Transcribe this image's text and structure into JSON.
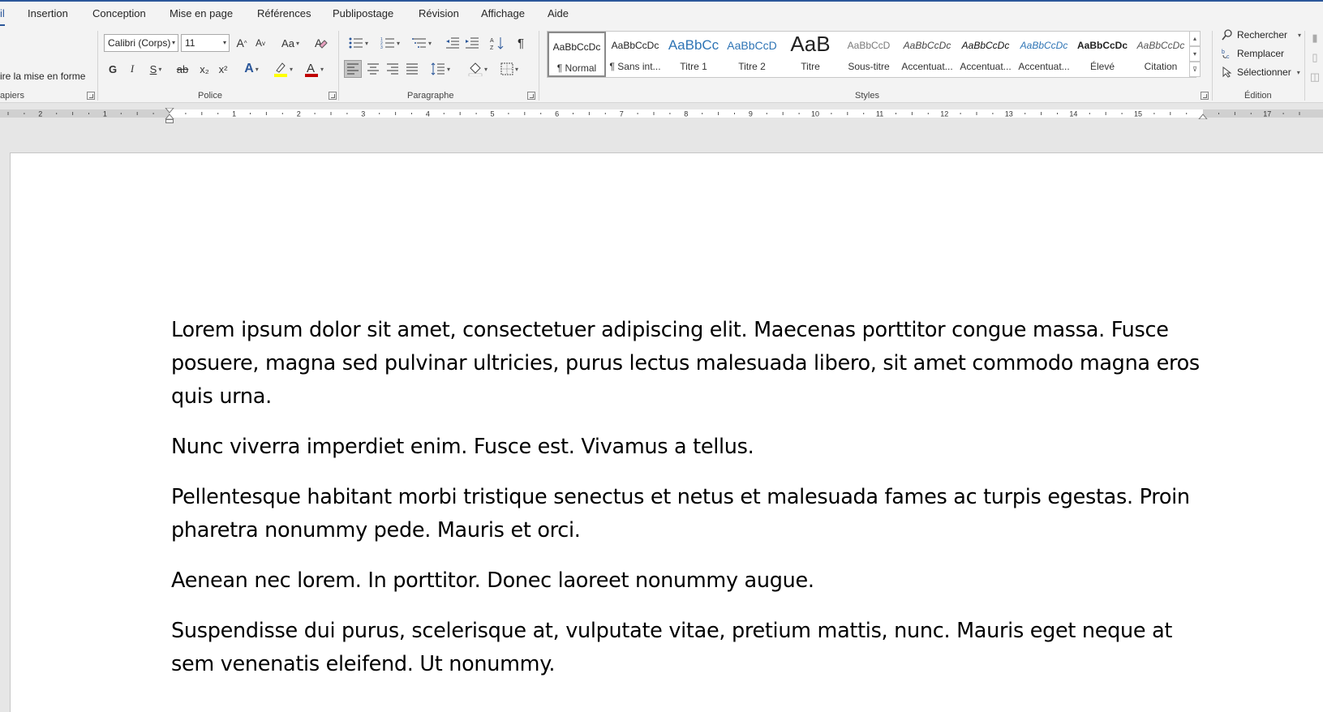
{
  "tabs": [
    {
      "label": "il",
      "active": true
    },
    {
      "label": "Insertion"
    },
    {
      "label": "Conception"
    },
    {
      "label": "Mise en page"
    },
    {
      "label": "Références"
    },
    {
      "label": "Publipostage"
    },
    {
      "label": "Révision"
    },
    {
      "label": "Affichage"
    },
    {
      "label": "Aide"
    }
  ],
  "clipboard": {
    "format_painter_label": "ire la mise en forme",
    "group_label": "apiers"
  },
  "font": {
    "group_label": "Police",
    "font_name": "Calibri (Corps)",
    "font_size": "11",
    "bold": "G",
    "italic": "I",
    "underline": "S",
    "strike": "ab",
    "subscript": "x₂",
    "superscript": "x²",
    "case": "Aa",
    "grow": "A",
    "shrink": "A"
  },
  "paragraph": {
    "group_label": "Paragraphe",
    "pilcrow": "¶"
  },
  "styles": {
    "group_label": "Styles",
    "items": [
      {
        "preview": "AaBbCcDc",
        "name": "¶ Normal"
      },
      {
        "preview": "AaBbCcDc",
        "name": "¶ Sans int..."
      },
      {
        "preview": "AaBbCc",
        "name": "Titre 1"
      },
      {
        "preview": "AaBbCcD",
        "name": "Titre 2"
      },
      {
        "preview": "AaB",
        "name": "Titre"
      },
      {
        "preview": "AaBbCcD",
        "name": "Sous-titre"
      },
      {
        "preview": "AaBbCcDc",
        "name": "Accentuat..."
      },
      {
        "preview": "AaBbCcDc",
        "name": "Accentuat..."
      },
      {
        "preview": "AaBbCcDc",
        "name": "Accentuat..."
      },
      {
        "preview": "AaBbCcDc",
        "name": "Élevé"
      },
      {
        "preview": "AaBbCcDc",
        "name": "Citation"
      }
    ]
  },
  "editing": {
    "group_label": "Édition",
    "find": "Rechercher",
    "replace": "Remplacer",
    "select": "Sélectionner"
  },
  "ruler": {
    "left_numbers": [
      "2",
      "1"
    ],
    "right_numbers": [
      "1",
      "2",
      "3",
      "4",
      "5",
      "6",
      "7",
      "8",
      "9",
      "10",
      "11",
      "12",
      "13",
      "14",
      "15",
      "17"
    ]
  },
  "document": {
    "paragraphs": [
      "Lorem ipsum dolor sit amet, consectetuer adipiscing elit. Maecenas porttitor congue massa. Fusce posuere, magna sed pulvinar ultricies, purus lectus malesuada libero, sit amet commodo magna eros quis urna.",
      "Nunc viverra imperdiet enim. Fusce est. Vivamus a tellus.",
      "Pellentesque habitant morbi tristique senectus et netus et malesuada fames ac turpis egestas. Proin pharetra nonummy pede. Mauris et orci.",
      "Aenean nec lorem. In porttitor. Donec laoreet nonummy augue.",
      "Suspendisse dui purus, scelerisque at, vulputate vitae, pretium mattis, nunc. Mauris eget neque at sem venenatis eleifend. Ut nonummy."
    ]
  },
  "colors": {
    "accent": "#2b579a",
    "highlight": "#ffff00",
    "font_color": "#c00000"
  }
}
